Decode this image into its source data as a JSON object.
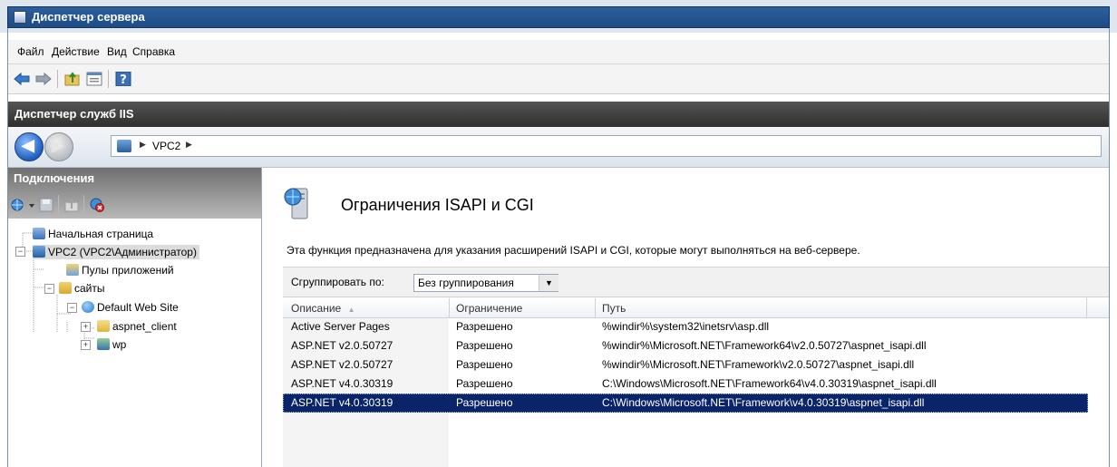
{
  "window": {
    "title": "Диспетчер сервера"
  },
  "menu": [
    "Файл",
    "Действие",
    "Вид",
    "Справка"
  ],
  "toolbar_icons": [
    "back-arrow-icon",
    "forward-arrow-icon",
    "folder-up-icon",
    "properties-icon",
    "help-icon"
  ],
  "iis": {
    "title": "Диспетчер служб IIS"
  },
  "nav": {
    "address_node": "VPC2",
    "separator": "▶"
  },
  "connections": {
    "title": "Подключения",
    "tree": [
      {
        "label": "Начальная страница",
        "icon": "start-page-icon"
      },
      {
        "label": "VPC2 (VPC2\\Администратор)",
        "icon": "server-icon"
      },
      {
        "label": "Пулы приложений",
        "icon": "app-pool-icon"
      },
      {
        "label": "сайты",
        "icon": "sites-folder-icon"
      },
      {
        "label": "Default Web Site",
        "icon": "globe-icon"
      },
      {
        "label": "aspnet_client",
        "icon": "folder-icon"
      },
      {
        "label": "wp",
        "icon": "app-icon"
      }
    ]
  },
  "feature": {
    "title": "Ограничения ISAPI и CGI",
    "description": "Эта функция предназначена для указания расширений ISAPI и CGI, которые могут выполняться на веб-сервере.",
    "group_label": "Сгруппировать по:",
    "group_value": "Без группирования"
  },
  "grid": {
    "columns": [
      "Описание",
      "Ограничение",
      "Путь"
    ],
    "sort_indicator": "▲",
    "rows": [
      {
        "description": "Active Server Pages",
        "restriction": "Разрешено",
        "path": "%windir%\\system32\\inetsrv\\asp.dll"
      },
      {
        "description": "ASP.NET v2.0.50727",
        "restriction": "Разрешено",
        "path": "%windir%\\Microsoft.NET\\Framework64\\v2.0.50727\\aspnet_isapi.dll"
      },
      {
        "description": "ASP.NET v2.0.50727",
        "restriction": "Разрешено",
        "path": "%windir%\\Microsoft.NET\\Framework\\v2.0.50727\\aspnet_isapi.dll"
      },
      {
        "description": "ASP.NET v4.0.30319",
        "restriction": "Разрешено",
        "path": "C:\\Windows\\Microsoft.NET\\Framework64\\v4.0.30319\\aspnet_isapi.dll"
      },
      {
        "description": "ASP.NET v4.0.30319",
        "restriction": "Разрешено",
        "path": "C:\\Windows\\Microsoft.NET\\Framework\\v4.0.30319\\aspnet_isapi.dll",
        "selected": true
      }
    ]
  },
  "colors": {
    "accent": "#1d4c86",
    "selection": "#0a246a",
    "header_dark": "#2f2f2f"
  }
}
